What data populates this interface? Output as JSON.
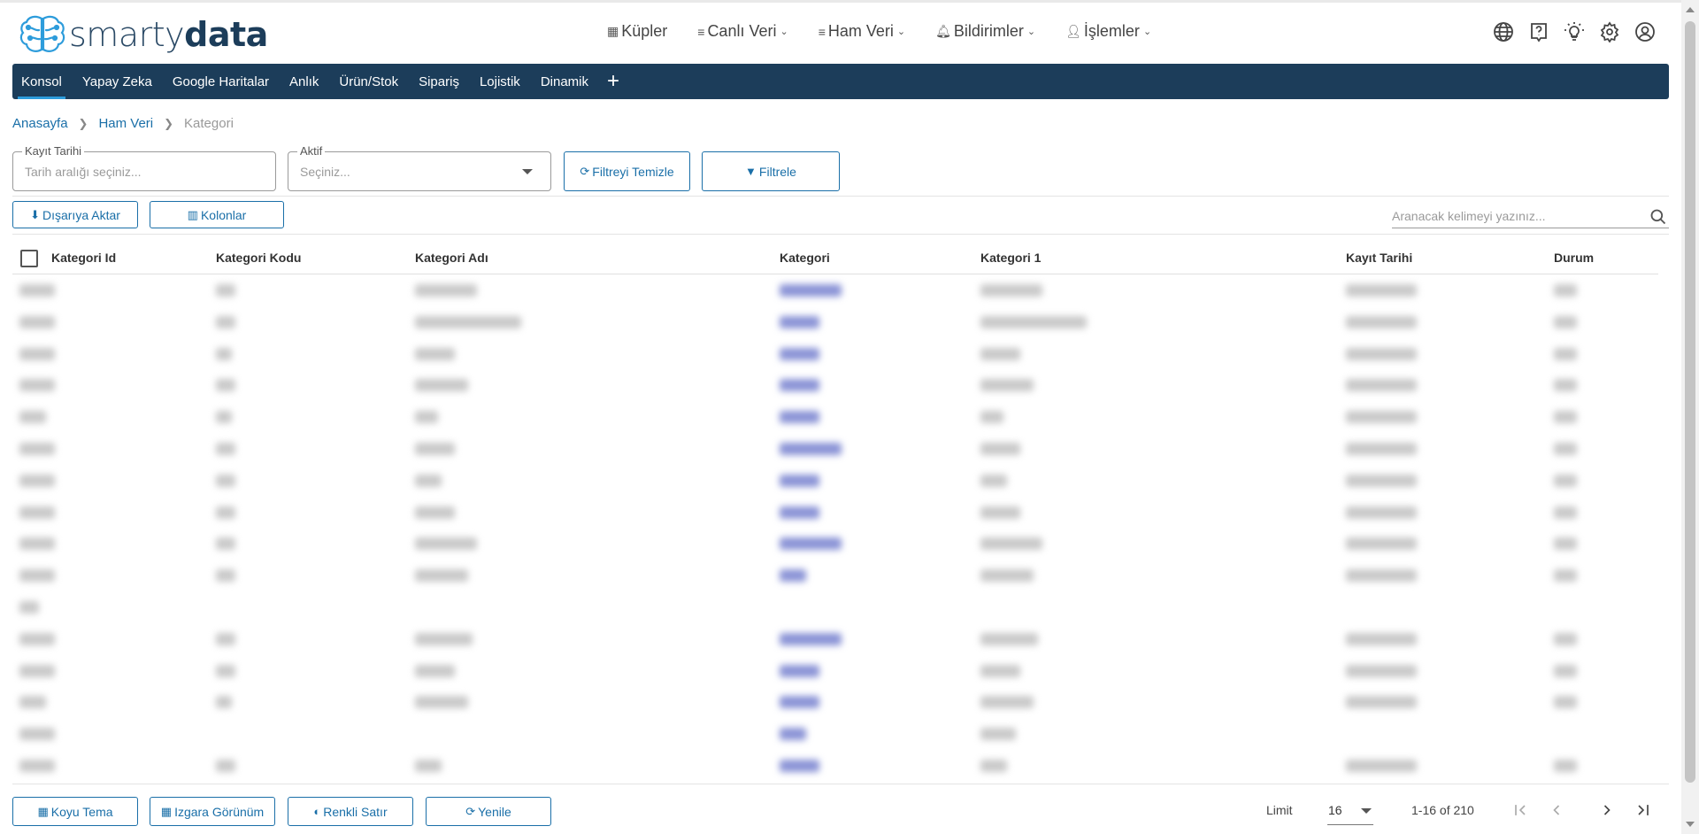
{
  "header": {
    "logo": {
      "part1": "smarty",
      "part2": "data"
    },
    "nav": [
      {
        "label": "Küpler",
        "icon": "grid-icon",
        "dropdown": false
      },
      {
        "label": "Canlı Veri",
        "icon": "list-icon",
        "dropdown": true
      },
      {
        "label": "Ham Veri",
        "icon": "list-icon",
        "dropdown": true
      },
      {
        "label": "Bildirimler",
        "icon": "bell-icon",
        "dropdown": true
      },
      {
        "label": "İşlemler",
        "icon": "user-gear-icon",
        "dropdown": true
      }
    ],
    "icons": [
      "globe-icon",
      "help-icon",
      "theme-bulb-icon",
      "settings-gear-icon",
      "account-icon"
    ]
  },
  "menu": {
    "items": [
      "Konsol",
      "Yapay Zeka",
      "Google Haritalar",
      "Anlık",
      "Ürün/Stok",
      "Sipariş",
      "Lojistik",
      "Dinamik"
    ],
    "active": "Konsol",
    "plus": "+"
  },
  "breadcrumb": {
    "items": [
      "Anasayfa",
      "Ham Veri"
    ],
    "current": "Kategori"
  },
  "filters": {
    "date": {
      "label": "Kayıt Tarihi",
      "placeholder": "Tarih aralığı seçiniz..."
    },
    "active": {
      "label": "Aktif",
      "placeholder": "Seçiniz..."
    },
    "clear_label": "Filtreyi Temizle",
    "filter_label": "Filtrele"
  },
  "toolbar": {
    "export_label": "Dışarıya Aktar",
    "columns_label": "Kolonlar"
  },
  "search": {
    "placeholder": "Aranacak kelimeyi yazınız..."
  },
  "table": {
    "columns": [
      "Kategori Id",
      "Kategori Kodu",
      "Kategori Adı",
      "Kategori",
      "Kategori 1",
      "Kayıt Tarihi",
      "Durum"
    ],
    "note": "row contents are blurred/redacted in the screenshot",
    "row_count_visible": 16
  },
  "footer": {
    "buttons": [
      "Koyu Tema",
      "Izgara Görünüm",
      "Renkli Satır",
      "Yenile"
    ],
    "limit_label": "Limit",
    "limit_value": "16",
    "range": "1-16 of 210"
  },
  "colors": {
    "primary": "#1a6fa8",
    "menubar": "#1c3d5a",
    "accent": "#2d9cdb"
  }
}
